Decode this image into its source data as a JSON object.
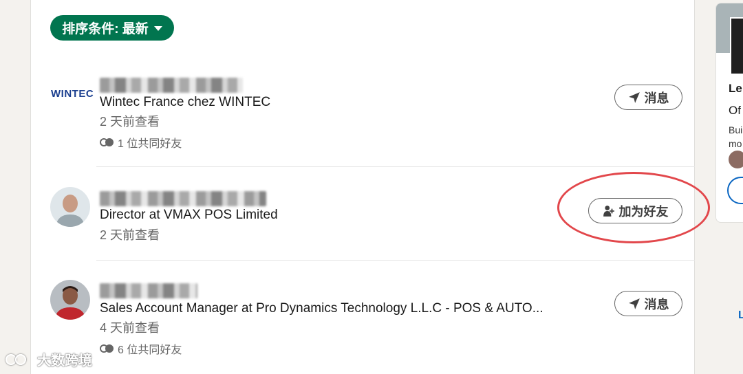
{
  "sort": {
    "label": "排序条件: 最新"
  },
  "results": [
    {
      "logo_text": "WINTEC",
      "headline": "Wintec France chez WINTEC",
      "viewed": "2 天前查看",
      "mutual": "1 位共同好友",
      "action": "消息"
    },
    {
      "headline": "Director at VMAX POS Limited",
      "viewed": "2 天前查看",
      "action": "加为好友"
    },
    {
      "headline": "Sales Account Manager at Pro Dynamics Technology L.L.C - POS & AUTO...",
      "viewed": "4 天前查看",
      "mutual": "6 位共同好友",
      "action": "消息"
    }
  ],
  "side_card": {
    "title": "Le",
    "subtitle": "Of",
    "desc_line1": "Bui",
    "desc_line2": "mo"
  },
  "side_link": "L",
  "watermark": "大数跨境",
  "colors": {
    "accent_green": "#01754f",
    "highlight_red": "#e2474b",
    "link_blue": "#0a66c2"
  }
}
